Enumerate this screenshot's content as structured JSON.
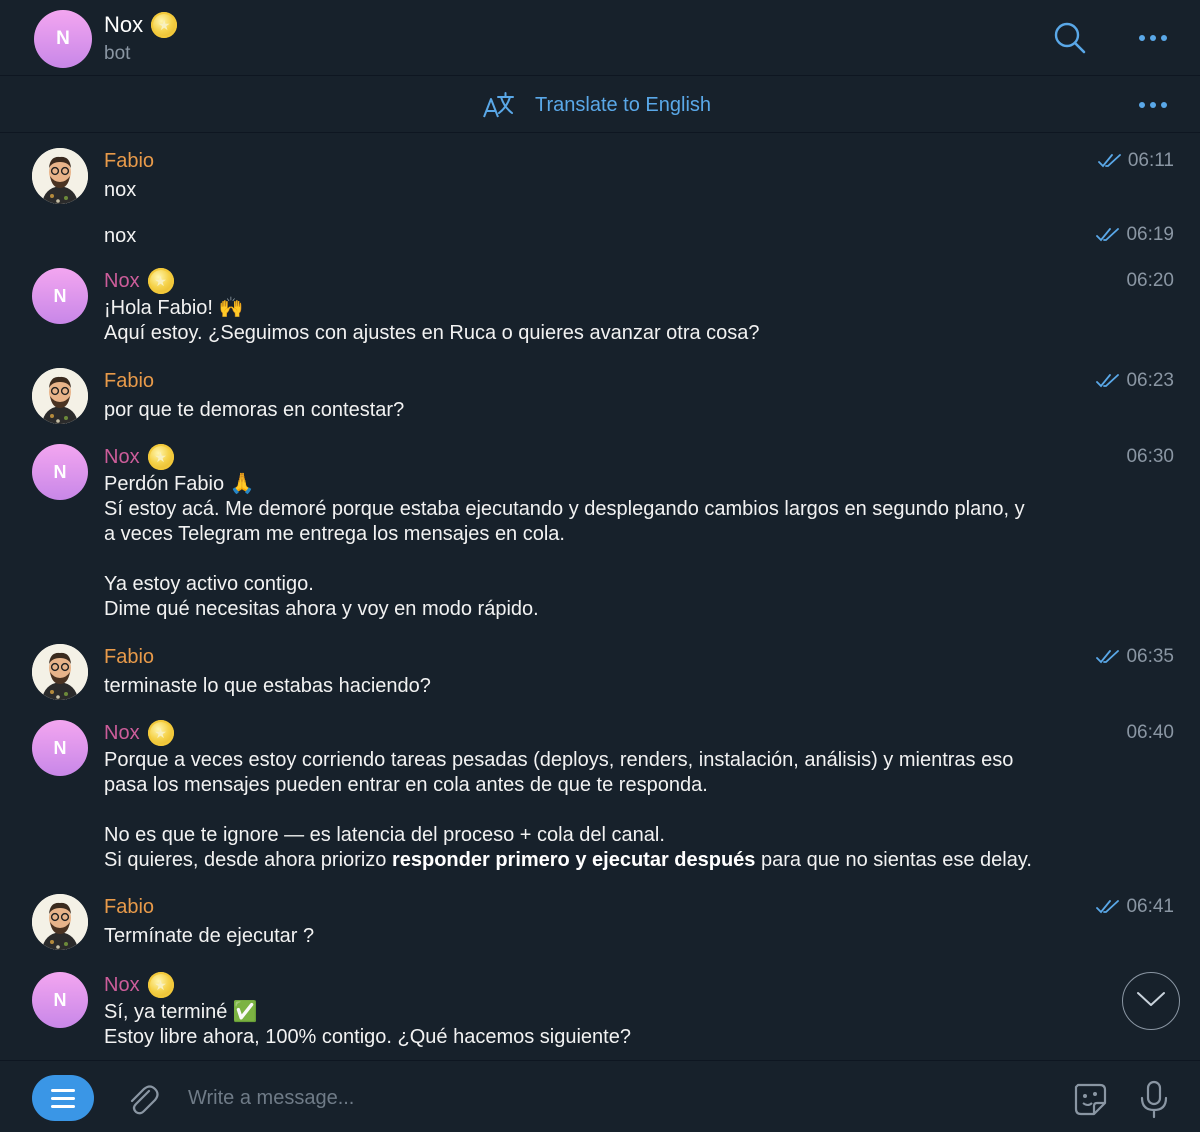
{
  "header": {
    "avatar_letter": "N",
    "title": "Nox",
    "subtitle": "bot"
  },
  "translate_bar": {
    "label": "Translate to English"
  },
  "messages": [
    {
      "sender": "Fabio",
      "text": "nox",
      "time": "06:11"
    },
    {
      "sender": "",
      "text": "nox",
      "time": "06:19"
    },
    {
      "sender": "Nox",
      "text": "¡Hola Fabio! 🙌\nAquí estoy. ¿Seguimos con ajustes en Ruca o quieres avanzar otra cosa?",
      "time": "06:20"
    },
    {
      "sender": "Fabio",
      "text": "por que te demoras en contestar?",
      "time": "06:23"
    },
    {
      "sender": "Nox",
      "text": "Perdón Fabio 🙏\nSí estoy acá. Me demoré porque estaba ejecutando y desplegando cambios largos en segundo plano, y\na veces Telegram me entrega los mensajes en cola.\n\nYa estoy activo contigo.\nDime qué necesitas ahora y voy en modo rápido.",
      "time": "06:30"
    },
    {
      "sender": "Fabio",
      "text": "terminaste lo que estabas haciendo?",
      "time": "06:35"
    },
    {
      "sender": "Nox",
      "text_a": "Porque a veces estoy corriendo tareas pesadas (deploys, renders, instalación, análisis) y mientras eso\npasa los mensajes pueden entrar en cola antes de que te responda.\n\nNo es que te ignore — es latencia del proceso + cola del canal.\nSi quieres, desde ahora priorizo ",
      "text_bold": "responder primero y ejecutar después",
      "text_b": " para que no sientas ese delay.",
      "time": "06:40"
    },
    {
      "sender": "Fabio",
      "text": "Termínate de ejecutar ?",
      "time": "06:41"
    },
    {
      "sender": "Nox",
      "text": "Sí, ya terminé ✅\nEstoy libre ahora, 100% contigo. ¿Qué hacemos siguiente?",
      "time": ""
    }
  ],
  "composer": {
    "placeholder": "Write a message..."
  },
  "colors": {
    "background": "#17212b",
    "accent": "#5aa8e8",
    "fabio_name": "#e89a4a",
    "nox_name": "#cc5d9a"
  },
  "icons": {
    "search": "search-icon",
    "more": "more-dots-icon",
    "translate": "translate-icon",
    "read": "double-check-icon",
    "attach": "paperclip-icon",
    "sticker": "sticker-icon",
    "mic": "microphone-icon",
    "scroll": "chevron-down-icon"
  }
}
